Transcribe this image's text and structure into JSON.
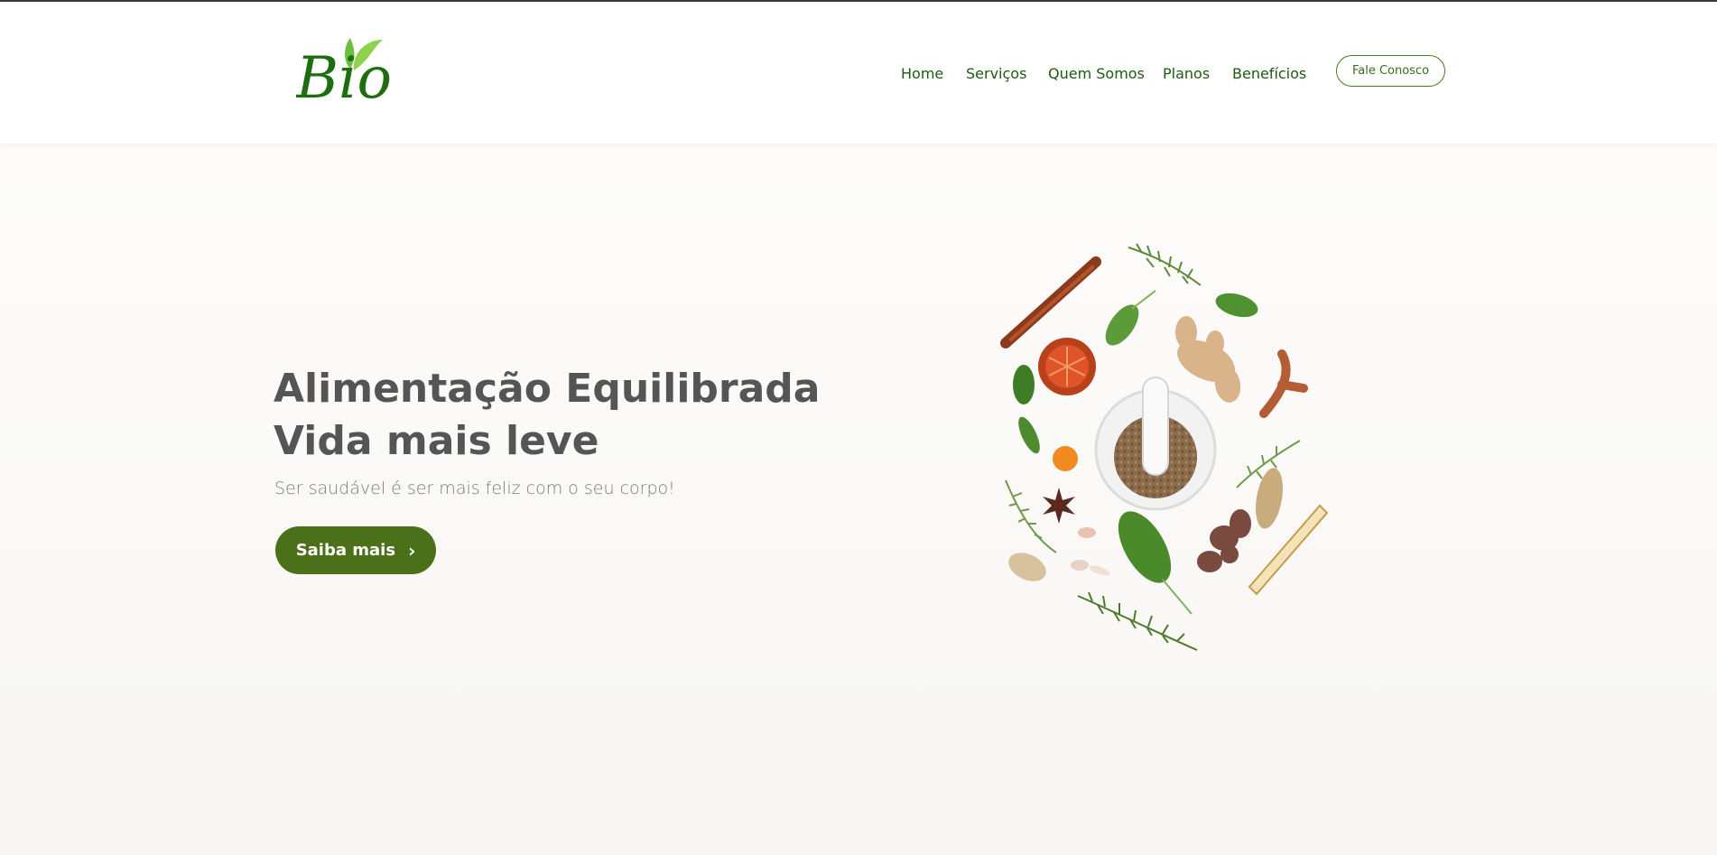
{
  "header": {
    "logo_text": "Bio",
    "nav": [
      {
        "label": "Home"
      },
      {
        "label": "Serviços"
      },
      {
        "label": "Quem Somos"
      },
      {
        "label": "Planos"
      },
      {
        "label": "Benefícios"
      }
    ],
    "cta_label": "Fale Conosco"
  },
  "hero": {
    "title_line1": "Alimentação Equilibrada",
    "title_line2": "Vida mais leve",
    "subtitle": "Ser saudável é ser mais feliz com o seu corpo!",
    "button_label": "Saiba mais",
    "button_icon": "chevron-right-icon"
  },
  "colors": {
    "brand_green": "#1f5a12",
    "button_green": "#4a7119",
    "leaf_light": "#8fd14f",
    "text_gray": "#555555"
  }
}
